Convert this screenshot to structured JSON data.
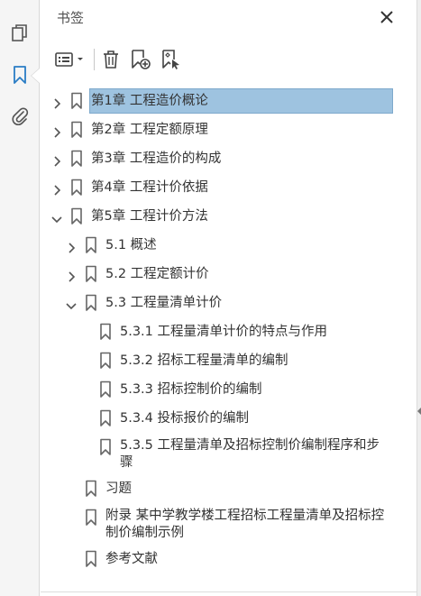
{
  "panel": {
    "title": "书签"
  },
  "icons": {
    "rail": [
      "pages-icon",
      "bookmarks-icon",
      "attachments-icon"
    ],
    "toolbar": [
      "options-menu-icon",
      "delete-bookmark-icon",
      "add-bookmark-icon",
      "new-bookmark-from-structure-icon"
    ],
    "close": "close-icon"
  },
  "colors": {
    "selection": "#9ec3e0",
    "accent": "#2a7dc5"
  },
  "bookmarks": [
    {
      "label": "第1章 工程造价概论",
      "level": 0,
      "state": "collapsed",
      "selected": true
    },
    {
      "label": "第2章 工程定额原理",
      "level": 0,
      "state": "collapsed"
    },
    {
      "label": "第3章 工程造价的构成",
      "level": 0,
      "state": "collapsed"
    },
    {
      "label": "第4章 工程计价依据",
      "level": 0,
      "state": "collapsed"
    },
    {
      "label": "第5章 工程计价方法",
      "level": 0,
      "state": "expanded"
    },
    {
      "label": "5.1 概述",
      "level": 1,
      "state": "collapsed"
    },
    {
      "label": "5.2 工程定额计价",
      "level": 1,
      "state": "collapsed"
    },
    {
      "label": "5.3 工程量清单计价",
      "level": 1,
      "state": "expanded"
    },
    {
      "label": "5.3.1 工程量清单计价的特点与作用",
      "level": 2,
      "state": "leaf"
    },
    {
      "label": "5.3.2 招标工程量清单的编制",
      "level": 2,
      "state": "leaf"
    },
    {
      "label": "5.3.3 招标控制价的编制",
      "level": 2,
      "state": "leaf"
    },
    {
      "label": "5.3.4 投标报价的编制",
      "level": 2,
      "state": "leaf"
    },
    {
      "label": "5.3.5 工程量清单及招标控制价编制程序和步骤",
      "level": 2,
      "state": "leaf"
    },
    {
      "label": "习题",
      "level": 1,
      "state": "leaf"
    },
    {
      "label": "附录 某中学教学楼工程招标工程量清单及招标控制价编制示例",
      "level": 1,
      "state": "leaf"
    },
    {
      "label": "参考文献",
      "level": 1,
      "state": "leaf"
    }
  ]
}
